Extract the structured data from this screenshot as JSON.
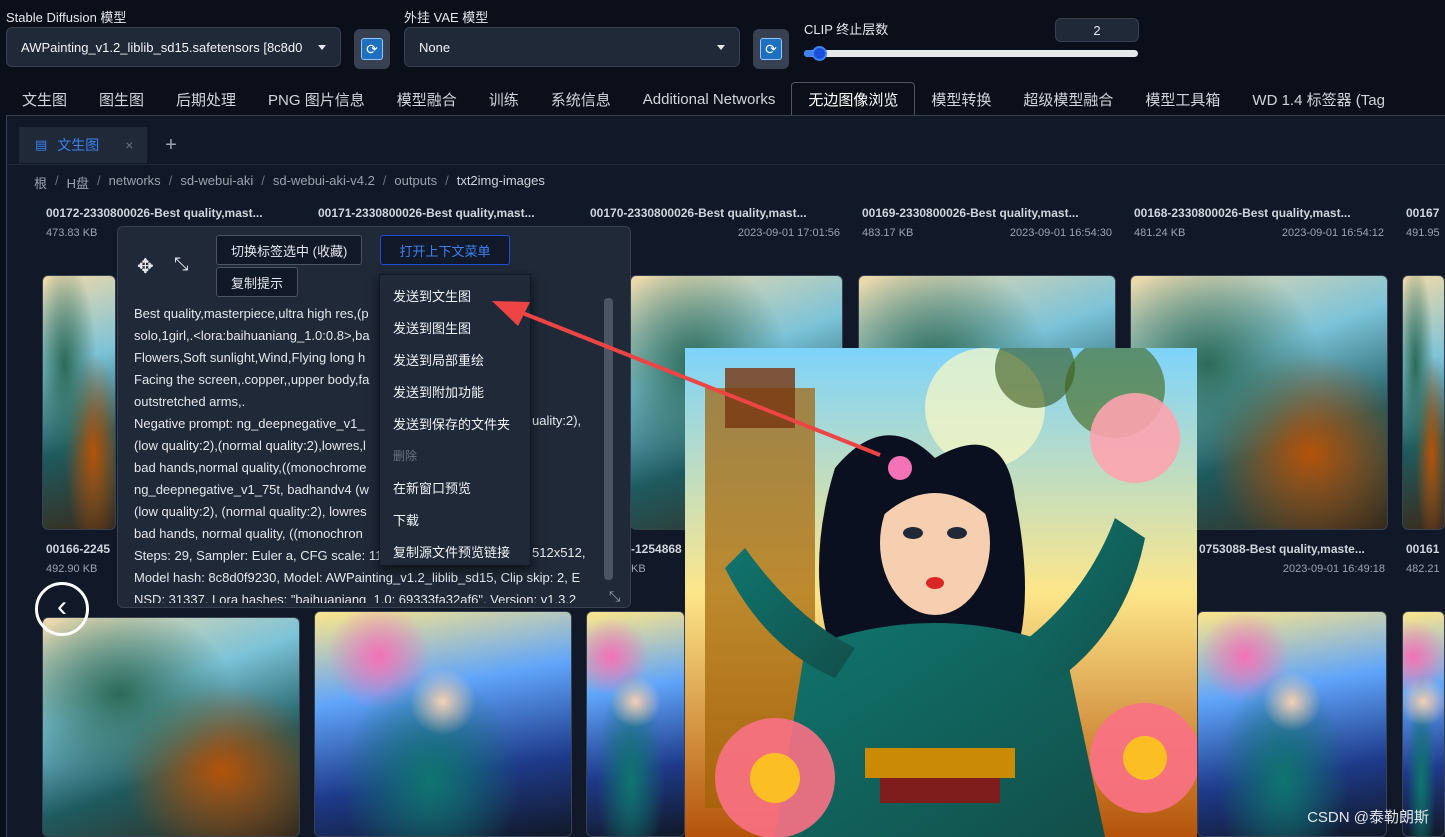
{
  "settings": {
    "sd_model": {
      "label": "Stable Diffusion 模型",
      "value": "AWPainting_v1.2_liblib_sd15.safetensors [8c8d0"
    },
    "vae": {
      "label": "外挂 VAE 模型",
      "value": "None"
    },
    "clip": {
      "label": "CLIP 终止层数",
      "value": "2",
      "slider_fraction": 0.03
    }
  },
  "tabs": [
    "文生图",
    "图生图",
    "后期处理",
    "PNG 图片信息",
    "模型融合",
    "训练",
    "系统信息",
    "Additional Networks",
    "无边图像浏览",
    "模型转换",
    "超级模型融合",
    "模型工具箱",
    "WD 1.4 标签器 (Tag"
  ],
  "active_tab": "无边图像浏览",
  "browser": {
    "subtab": "文生图",
    "subtab_close": "×",
    "add_tab": "+",
    "breadcrumb": [
      "根",
      "H盘",
      "networks",
      "sd-webui-aki",
      "sd-webui-aki-v4.2",
      "outputs",
      "txt2img-images"
    ],
    "separator": "/"
  },
  "files_row1": [
    {
      "name": "00172-2330800026-Best quality,mast...",
      "size": "473.83 KB",
      "date": ""
    },
    {
      "name": "00171-2330800026-Best quality,mast...",
      "size": "",
      "date": ""
    },
    {
      "name": "00170-2330800026-Best quality,mast...",
      "size": "KB",
      "date": "2023-09-01 17:01:56"
    },
    {
      "name": "00169-2330800026-Best quality,mast...",
      "size": "483.17 KB",
      "date": "2023-09-01 16:54:30"
    },
    {
      "name": "00168-2330800026-Best quality,mast...",
      "size": "481.24 KB",
      "date": "2023-09-01 16:54:12"
    },
    {
      "name": "00167",
      "size": "491.95",
      "date": ""
    }
  ],
  "files_row2": [
    {
      "name": "00166-2245",
      "size": "492.90 KB",
      "date": ""
    },
    {
      "name": "-1254868",
      "size": "KB",
      "date": ""
    },
    {
      "name": "0753088-Best quality,maste...",
      "size": "",
      "date": "2023-09-01 16:49:18"
    },
    {
      "name": "00161",
      "size": "482.21",
      "date": ""
    }
  ],
  "popup": {
    "toggle_tag_button": "切换标签选中 (收藏)",
    "copy_prompt_button": "复制提示",
    "open_menu_button": "打开上下文菜单",
    "prompt_lines": [
      "Best quality,masterpiece,ultra high res,(p",
      "solo,1girl,.<lora:baihuaniang_1.0:0.8>,ba",
      "Flowers,Soft sunlight,Wind,Flying long h",
      "Facing the screen,.copper,,upper body,fa",
      "outstretched arms,.",
      "Negative prompt: ng_deepnegative_v1_",
      "(low quality:2),(normal quality:2),lowres,l",
      "bad hands,normal quality,((monochrome",
      "ng_deepnegative_v1_75t, badhandv4 (w",
      "(low quality:2), (normal quality:2), lowres",
      "bad hands, normal quality, ((monochron",
      "Steps: 29, Sampler: Euler a, CFG scale: 11",
      "Model hash: 8c8d0f9230, Model: AWPainting_v1.2_liblib_sd15, Clip skip: 2, E",
      "NSD: 31337, Lora hashes: \"baihuaniang_1.0: 69333fa32af6\", Version: v1.3.2"
    ],
    "prompt_right_fragments": {
      "line6": "uality:2),",
      "line12": "512x512,"
    }
  },
  "context_menu": [
    {
      "label": "发送到文生图",
      "disabled": false
    },
    {
      "label": "发送到图生图",
      "disabled": false
    },
    {
      "label": "发送到局部重绘",
      "disabled": false
    },
    {
      "label": "发送到附加功能",
      "disabled": false
    },
    {
      "label": "发送到保存的文件夹",
      "disabled": false
    },
    {
      "label": "删除",
      "disabled": true
    },
    {
      "label": "在新窗口预览",
      "disabled": false
    },
    {
      "label": "下载",
      "disabled": false
    },
    {
      "label": "复制源文件预览链接",
      "disabled": false
    }
  ],
  "watermark": "CSDN @泰勒朗斯",
  "colors": {
    "accent": "#3b82f6",
    "arrow": "#ef4444",
    "background": "#0b0f19"
  }
}
